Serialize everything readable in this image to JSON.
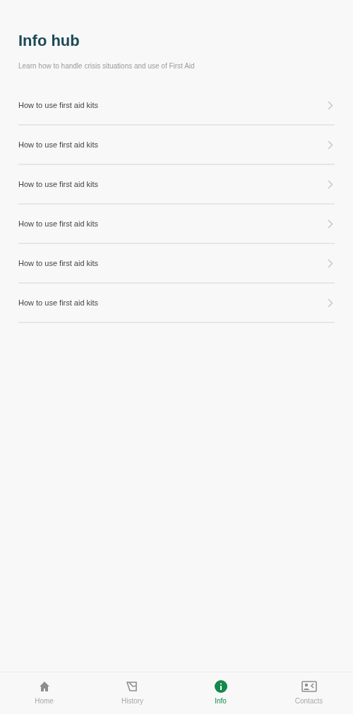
{
  "header": {
    "title": "Info hub",
    "subtitle": "Learn how to handle crisis situations and use of First Aid"
  },
  "items": [
    {
      "label": "How to use first aid kits"
    },
    {
      "label": "How to use first aid kits"
    },
    {
      "label": "How to use first aid kits"
    },
    {
      "label": "How to use first aid kits"
    },
    {
      "label": "How to use first aid kits"
    },
    {
      "label": "How to use first aid kits"
    }
  ],
  "bottom_nav": [
    {
      "kind": "home",
      "label": "Home",
      "selected": false
    },
    {
      "kind": "history",
      "label": "History",
      "selected": false
    },
    {
      "kind": "info",
      "label": "Info",
      "selected": true
    },
    {
      "kind": "contacts",
      "label": "Contacts",
      "selected": false
    }
  ]
}
